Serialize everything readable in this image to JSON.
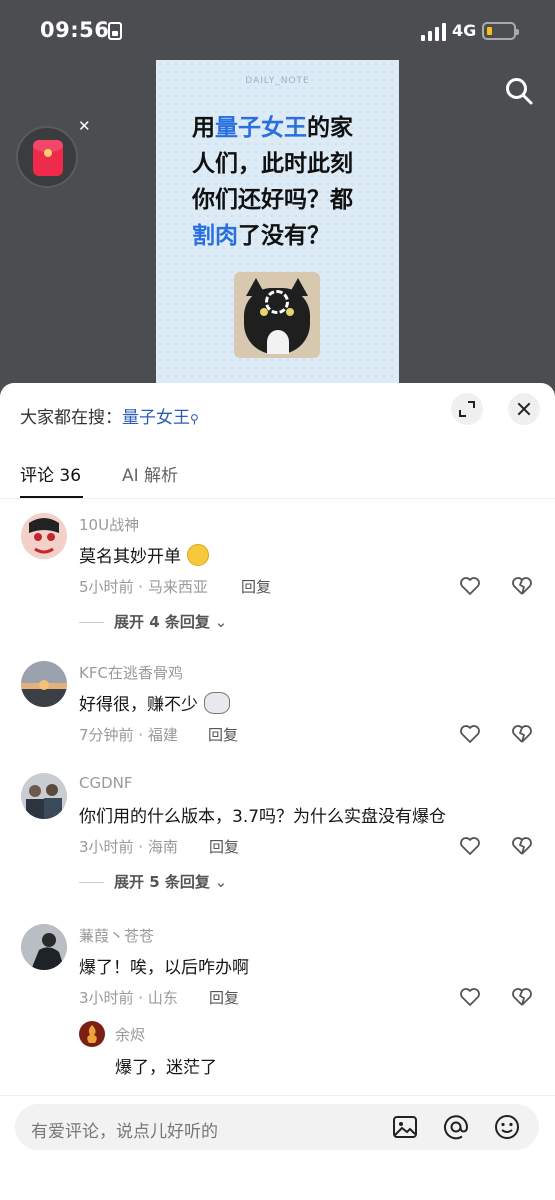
{
  "status_bar": {
    "time": "09:56",
    "network": "4G"
  },
  "video": {
    "card_tag": "DAILY_NOTE",
    "card_text": [
      {
        "t": "用",
        "hl": false
      },
      {
        "t": "量子女王",
        "hl": true
      },
      {
        "t": "的家人们，此时此刻你们还好吗？都",
        "hl": false
      },
      {
        "t": "割肉",
        "hl": true
      },
      {
        "t": "了没有？",
        "hl": false
      }
    ]
  },
  "sheet": {
    "hot_search_prefix": "大家都在搜：",
    "hot_search_keyword": "量子女王",
    "tabs": {
      "comments": "评论 36",
      "ai": "AI 解析"
    }
  },
  "comments": [
    {
      "user": "10U战神",
      "text": "莫名其妙开单",
      "emoji": "smile",
      "meta": "5小时前 · 马来西亚",
      "reply": "回复",
      "expand": "展开 4 条回复"
    },
    {
      "user": "KFC在逃香骨鸡",
      "text": "好得很，赚不少",
      "emoji": "dog",
      "meta": "7分钟前 · 福建",
      "reply": "回复",
      "expand": ""
    },
    {
      "user": "CGDNF",
      "text": "你们用的什么版本，3.7吗？为什么实盘没有爆仓",
      "emoji": "",
      "meta": "3小时前 · 海南",
      "reply": "回复",
      "expand": "展开 5 条回复"
    },
    {
      "user": "蒹葭丶苍苍",
      "text": "爆了！唉，以后咋办啊",
      "emoji": "",
      "meta": "3小时前 · 山东",
      "reply": "回复",
      "expand": ""
    }
  ],
  "sub_reply": {
    "user": "余烬",
    "text": "爆了，迷茫了"
  },
  "input": {
    "placeholder": "有爱评论，说点儿好听的"
  },
  "icons": [
    "search-icon",
    "red-envelope-icon",
    "close-icon",
    "expand-icon",
    "heart-icon",
    "broken-heart-icon",
    "image-icon",
    "at-icon",
    "emoji-icon"
  ]
}
